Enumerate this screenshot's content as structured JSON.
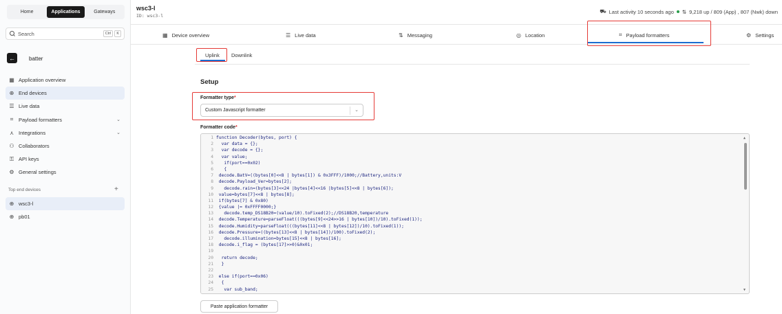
{
  "topnav": {
    "home": "Home",
    "applications": "Applications",
    "gateways": "Gateways"
  },
  "search": {
    "label": "Search",
    "kbd1": "Ctrl",
    "kbd2": "K"
  },
  "app": {
    "name": "batter"
  },
  "sidebar": {
    "items": [
      {
        "label": "Application overview",
        "icon": "grid-icon"
      },
      {
        "label": "End devices",
        "icon": "globe-icon",
        "active": true
      },
      {
        "label": "Live data",
        "icon": "list-icon"
      },
      {
        "label": "Payload formatters",
        "icon": "code-icon",
        "expand": true
      },
      {
        "label": "Integrations",
        "icon": "integrations-icon",
        "expand": true
      },
      {
        "label": "Collaborators",
        "icon": "users-icon"
      },
      {
        "label": "API keys",
        "icon": "key-icon"
      },
      {
        "label": "General settings",
        "icon": "gear-icon"
      }
    ],
    "section_title": "Top end devices",
    "devices": [
      {
        "label": "wsc3-l",
        "active": true
      },
      {
        "label": "pb01"
      }
    ]
  },
  "header": {
    "title": "wsc3-l",
    "id_line": "ID: wsc3-l",
    "activity": "Last activity 10 seconds ago",
    "traffic": "9,218 up / 809 (App) , 807 (Nwk) down"
  },
  "tabs": {
    "device_overview": "Device overview",
    "live_data": "Live data",
    "messaging": "Messaging",
    "location": "Location",
    "payload_formatters": "Payload formatters",
    "settings": "Settings"
  },
  "subtabs": {
    "uplink": "Uplink",
    "downlink": "Downlink"
  },
  "form": {
    "section": "Setup",
    "formatter_type_label": "Formatter type",
    "formatter_type_value": "Custom Javascript formatter",
    "formatter_code_label": "Formatter code",
    "required_mark": "*",
    "paste_button": "Paste application formatter"
  },
  "code_lines": [
    "function Decoder(bytes, port) {",
    "  var data = {};",
    "  var decode = {};",
    "  var value;",
    "   if(port==0x02)",
    "   {",
    " decode.BatV=((bytes[0]<<8 | bytes[1]) & 0x3FFF)/1000;//Battery,units:V",
    " decode.Payload_Ver=bytes[2];",
    "   decode.rain=(bytes[3]<<24 |bytes[4]<<16 |bytes[5]<<8 | bytes[6]);",
    " value=bytes[7]<<8 | bytes[8];",
    " if(bytes[7] & 0x80)",
    " {value |= 0xFFFF0000;}",
    "   decode.temp_DS18B20=(value/10).toFixed(2);//DS18B20,temperature",
    " decode.Temperature=parseFloat(((bytes[9]<<24>>16 | bytes[10])/10).toFixed(1));",
    " decode.Humidity=parseFloat(((bytes[11]<<8 | bytes[12])/10).toFixed(1));",
    " decode.Pressure=((bytes[13]<<8 | bytes[14])/100).toFixed(2);",
    "   decode.illumination=bytes[15]<<8 | bytes[16];",
    " decode.i_flag = (bytes[17]>>0)&0x01;",
    "",
    "  return decode;",
    "  }",
    "",
    " else if(port==0x06)",
    "  {",
    "   var sub_band;"
  ]
}
